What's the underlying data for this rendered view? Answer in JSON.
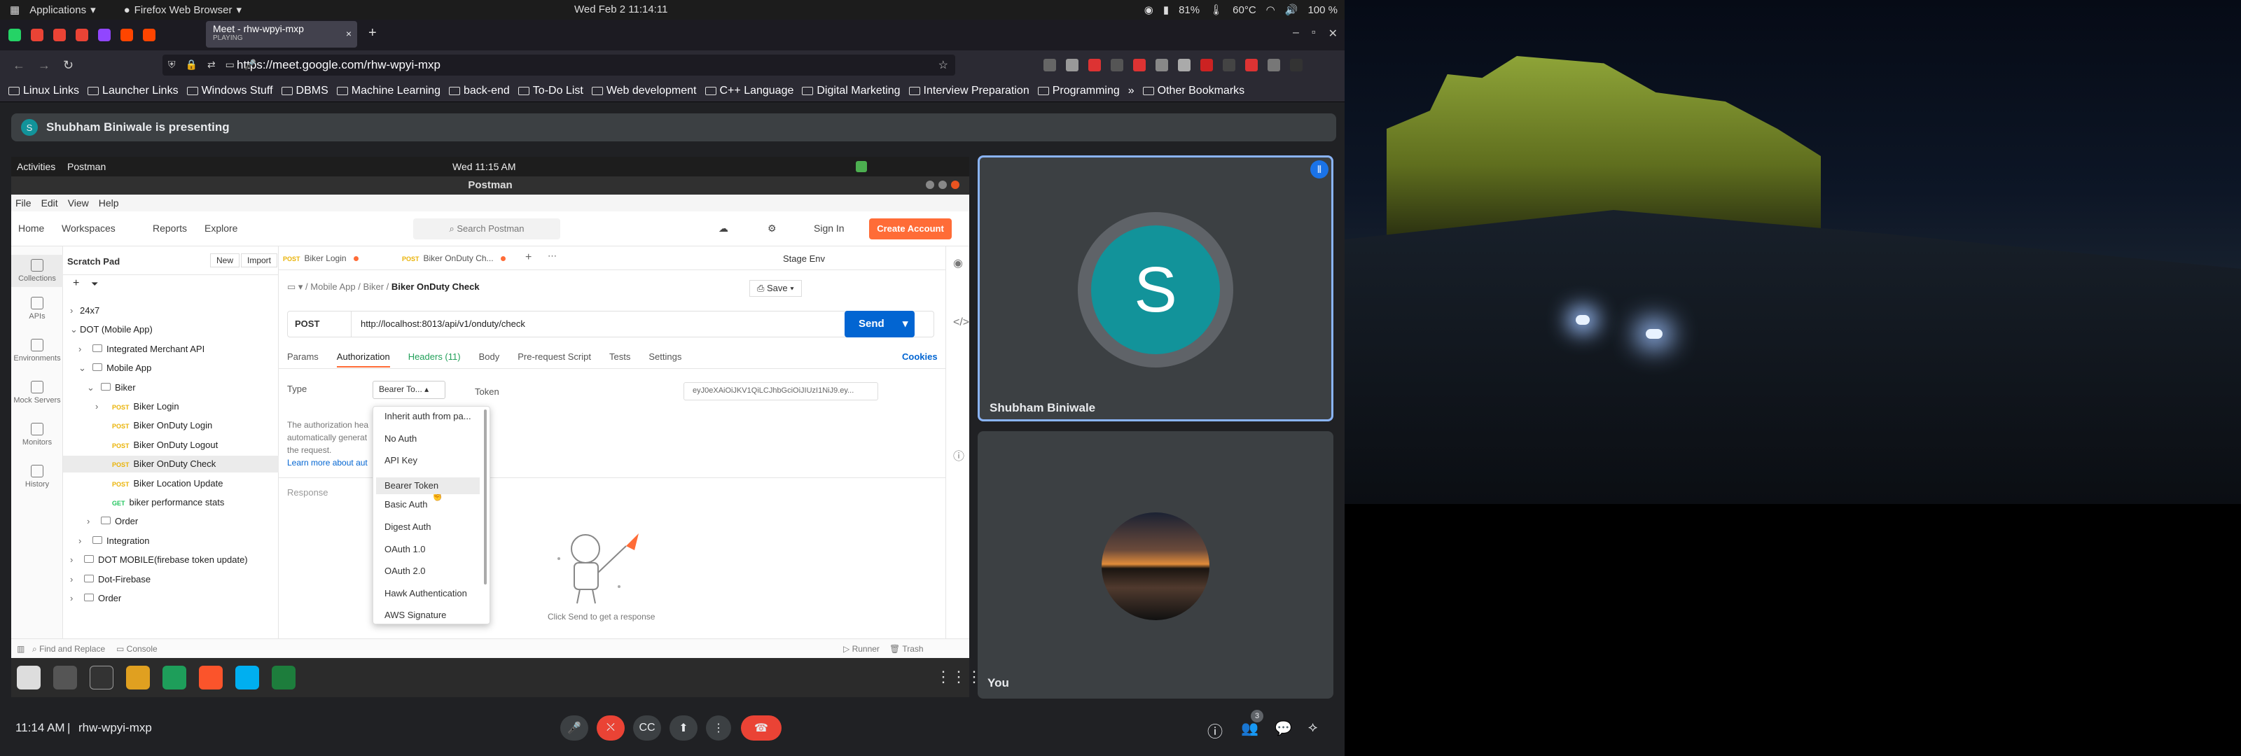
{
  "panel": {
    "applications": "Applications",
    "browser": "Firefox Web Browser",
    "clock": "Wed Feb 2  11:14:11",
    "battery": "81%",
    "temp": "60°C",
    "volume": "100 %"
  },
  "tab": {
    "title": "Meet - rhw-wpyi-mxp",
    "status": "PLAYING"
  },
  "url": "https://meet.google.com/rhw-wpyi-mxp",
  "bookmarks": [
    "Linux Links",
    "Launcher Links",
    "Windows Stuff",
    "DBMS",
    "Machine Learning",
    "back-end",
    "To-Do List",
    "Web development",
    "C++ Language",
    "Digital Marketing",
    "Interview Preparation",
    "Programming",
    "Other Bookmarks"
  ],
  "presenting": {
    "avatar": "S",
    "text": "Shubham Biniwale is presenting"
  },
  "shared": {
    "gnome": {
      "activities": "Activities",
      "app": "Postman",
      "clock": "Wed 11:15 AM"
    },
    "window_title": "Postman",
    "menu": [
      "File",
      "Edit",
      "View",
      "Help"
    ],
    "header": {
      "home": "Home",
      "workspaces": "Workspaces",
      "reports": "Reports",
      "explore": "Explore",
      "search": "Search Postman",
      "signin": "Sign In",
      "create": "Create Account"
    },
    "scratch": "Scratch Pad",
    "new_btn": "New",
    "import_btn": "Import",
    "leftnav": [
      "Collections",
      "APIs",
      "Environments",
      "Mock Servers",
      "Monitors",
      "History"
    ],
    "tree": [
      {
        "label": "24x7"
      },
      {
        "label": "DOT (Mobile App)"
      },
      {
        "label": "Integrated Merchant API"
      },
      {
        "label": "Mobile App"
      },
      {
        "label": "Biker"
      },
      {
        "label": "Biker Login",
        "method": "POST"
      },
      {
        "label": "Biker OnDuty Login",
        "method": "POST"
      },
      {
        "label": "Biker OnDuty Logout",
        "method": "POST"
      },
      {
        "label": "Biker OnDuty Check",
        "method": "POST"
      },
      {
        "label": "Biker Location Update",
        "method": "POST"
      },
      {
        "label": "biker performance stats",
        "method": "GET"
      },
      {
        "label": "Order"
      },
      {
        "label": "Integration"
      },
      {
        "label": "DOT MOBILE(firebase token update)"
      },
      {
        "label": "Dot-Firebase"
      },
      {
        "label": "Order"
      }
    ],
    "tabs": [
      {
        "method": "POST",
        "name": "Biker Login"
      },
      {
        "method": "POST",
        "name": "Biker OnDuty Ch..."
      }
    ],
    "env": "Stage Env",
    "breadcrumb": {
      "a": "Mobile App",
      "b": "Biker",
      "c": "Biker OnDuty Check"
    },
    "save": "Save",
    "method": "POST",
    "request_url": "http://localhost:8013/api/v1/onduty/check",
    "send": "Send",
    "req_tabs": [
      "Params",
      "Authorization",
      "Headers (11)",
      "Body",
      "Pre-request Script",
      "Tests",
      "Settings"
    ],
    "cookies": "Cookies",
    "type_label": "Type",
    "type_value": "Bearer To...",
    "token_label": "Token",
    "token_value": "eyJ0eXAiOiJKV1QiLCJhbGciOiJIUzI1NiJ9.ey...",
    "auth_desc": [
      "The authorization hea",
      "automatically generat",
      "the request."
    ],
    "learn": "Learn more about aut",
    "auth_options": [
      "Inherit auth from pa...",
      "No Auth",
      "API Key",
      "Bearer Token",
      "Basic Auth",
      "Digest Auth",
      "OAuth 1.0",
      "OAuth 2.0",
      "Hawk Authentication",
      "AWS Signature"
    ],
    "response": "Response",
    "response_hint": "Click Send to get a response",
    "footer": {
      "find": "Find and Replace",
      "console": "Console",
      "runner": "Runner",
      "trash": "Trash"
    }
  },
  "tiles": {
    "shubham": {
      "initial": "S",
      "name": "Shubham Biniwale"
    },
    "you": {
      "name": "You"
    }
  },
  "bottom": {
    "time": "11:14 AM",
    "sep": "|",
    "code": "rhw-wpyi-mxp",
    "participants": "3"
  }
}
